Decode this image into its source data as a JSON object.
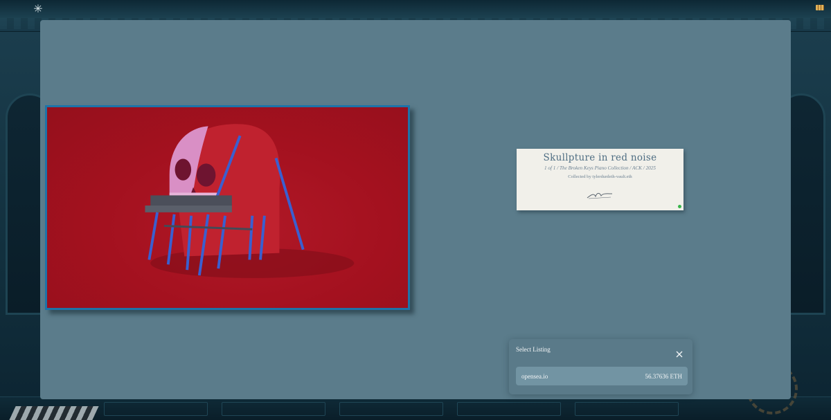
{
  "app": {
    "logo_icon": "asterisk-logo-icon",
    "corner_icon": "books-icon"
  },
  "artwork": {
    "description_icon": "skull-piano-artwork",
    "background_color": "#a4111f",
    "frame_color": "#1e73a8"
  },
  "label": {
    "title": "Skullpture in red noise",
    "subtitle": "1 of 1 / The Broken Keys Piano Collection / ACK / 2025",
    "collector": "Collected by tylerdurdeth-vault.eth",
    "signature_icon": "signature-icon",
    "status_color": "#39b54a"
  },
  "listing": {
    "title": "Select Listing",
    "close_icon": "close-icon",
    "items": [
      {
        "marketplace": "opensea.io",
        "price": "56.37636 ETH"
      }
    ]
  },
  "colors": {
    "overlay": "#5b7c8b",
    "card": "#f1f0ea",
    "popup": "#5a7a89",
    "listing_row": "#7294a3"
  }
}
